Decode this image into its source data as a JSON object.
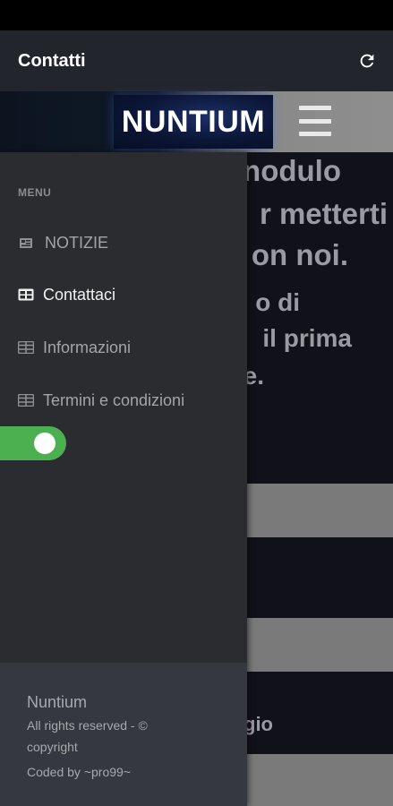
{
  "appbar": {
    "title": "Contatti",
    "refresh_icon": "refresh-icon"
  },
  "background_page": {
    "logo_text": "NUNTIUM",
    "menu_icon": "hamburger-menu-icon",
    "visible_text_fragments": [
      "nodulo",
      "r metterti",
      "on noi.",
      "o di",
      "il prima",
      "e.",
      "gio"
    ]
  },
  "drawer": {
    "menu_header": "MENU",
    "items": [
      {
        "label": "NOTIZIE",
        "icon": "newspaper-icon",
        "active": false
      },
      {
        "label": "Contattaci",
        "icon": "table-icon",
        "active": true
      },
      {
        "label": "Informazioni",
        "icon": "table-icon",
        "active": false
      },
      {
        "label": "Termini e condizioni",
        "icon": "table-icon",
        "active": false
      }
    ],
    "toggle": {
      "state": "on",
      "color": "#4caf50"
    },
    "footer": {
      "brand": "Nuntium",
      "line1": "All rights reserved - ©",
      "line2": "copyright",
      "line3": "Coded by ~pro99~"
    }
  },
  "colors": {
    "appbar_bg": "#22252b",
    "drawer_bg": "#2a2c30",
    "footer_bg": "#35383e",
    "page_bg": "#111119",
    "accent_toggle": "#4caf50"
  }
}
